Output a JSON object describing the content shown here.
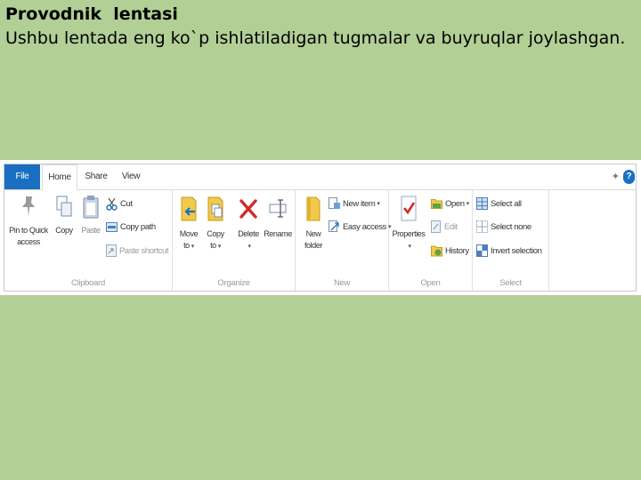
{
  "slide": {
    "title": "Provodnik  lentasi",
    "body": "Ushbu lentada eng ko`p ishlatiladigan tugmalar va buyruqlar joylashgan."
  },
  "ribbon": {
    "tabs": [
      "File",
      "Home",
      "Share",
      "View"
    ],
    "active_tab": "Home",
    "accent_color": "#1a6fc2",
    "help_label": "?",
    "groups": {
      "clipboard": {
        "label": "Clipboard",
        "pin_line1": "Pin to Quick",
        "pin_line2": "access",
        "copy": "Copy",
        "paste": "Paste",
        "cut": "Cut",
        "copy_path": "Copy path",
        "paste_shortcut": "Paste shortcut"
      },
      "organize": {
        "label": "Organize",
        "move_line1": "Move",
        "move_line2": "to",
        "copy_line1": "Copy",
        "copy_line2": "to",
        "delete": "Delete",
        "rename": "Rename"
      },
      "new": {
        "label": "New",
        "folder_line1": "New",
        "folder_line2": "folder",
        "new_item": "New item",
        "easy_access": "Easy access"
      },
      "open": {
        "label": "Open",
        "properties": "Properties",
        "open": "Open",
        "edit": "Edit",
        "history": "History"
      },
      "select": {
        "label": "Select",
        "select_all": "Select all",
        "select_none": "Select none",
        "invert_selection": "Invert selection"
      }
    }
  }
}
